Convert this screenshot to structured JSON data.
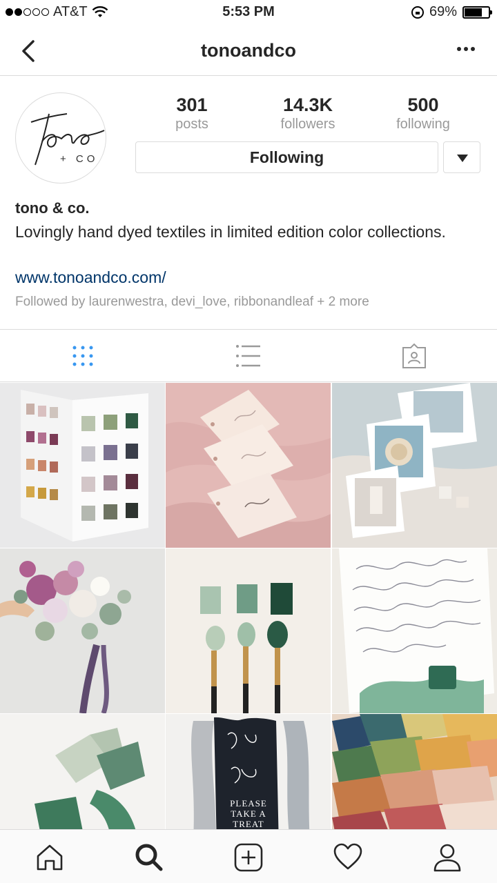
{
  "status_bar": {
    "carrier": "AT&T",
    "time": "5:53 PM",
    "battery": "69%",
    "battery_level": 0.69
  },
  "nav": {
    "title": "tonoandco"
  },
  "profile": {
    "avatar_logo_text": "tono + CO",
    "stats": [
      {
        "value": "301",
        "label": "posts"
      },
      {
        "value": "14.3K",
        "label": "followers"
      },
      {
        "value": "500",
        "label": "following"
      }
    ],
    "follow_button_label": "Following",
    "name": "tono & co.",
    "bio": "Lovingly hand dyed textiles in limited edition color collections.",
    "website": "www.tonoandco.com/",
    "followed_by": "Followed by laurenwestra, devi_love, ribbonandleaf + 2 more"
  },
  "tabs": [
    {
      "name": "grid-view",
      "icon": "grid-icon",
      "active": true
    },
    {
      "name": "list-view",
      "icon": "list-icon",
      "active": false
    },
    {
      "name": "tagged",
      "icon": "tagged-photos-icon",
      "active": false
    }
  ],
  "grid": {
    "photos": [
      {
        "subject": "color card",
        "text": ""
      },
      {
        "subject": "enjoy tags on pink fabric",
        "text": ""
      },
      {
        "subject": "photos on linen",
        "text": ""
      },
      {
        "subject": "bouquet with ribbon",
        "text": ""
      },
      {
        "subject": "green swatches and brushes",
        "text": ""
      },
      {
        "subject": "calligraphy note",
        "text": ""
      },
      {
        "subject": "green ribbons",
        "text": ""
      },
      {
        "subject": "love is sweet card",
        "text": "PLEASE TAKE A TREAT"
      },
      {
        "subject": "colored fabric stack",
        "text": ""
      }
    ]
  },
  "bottom_nav": [
    {
      "name": "home",
      "icon": "home-icon"
    },
    {
      "name": "search",
      "icon": "search-icon",
      "active": true
    },
    {
      "name": "new-post",
      "icon": "add-post-icon"
    },
    {
      "name": "activity",
      "icon": "heart-icon"
    },
    {
      "name": "profile",
      "icon": "profile-icon"
    }
  ],
  "colors": {
    "link": "#003569",
    "muted": "#999999",
    "border": "#dbdbdb",
    "active_tab": "#3897f0"
  }
}
